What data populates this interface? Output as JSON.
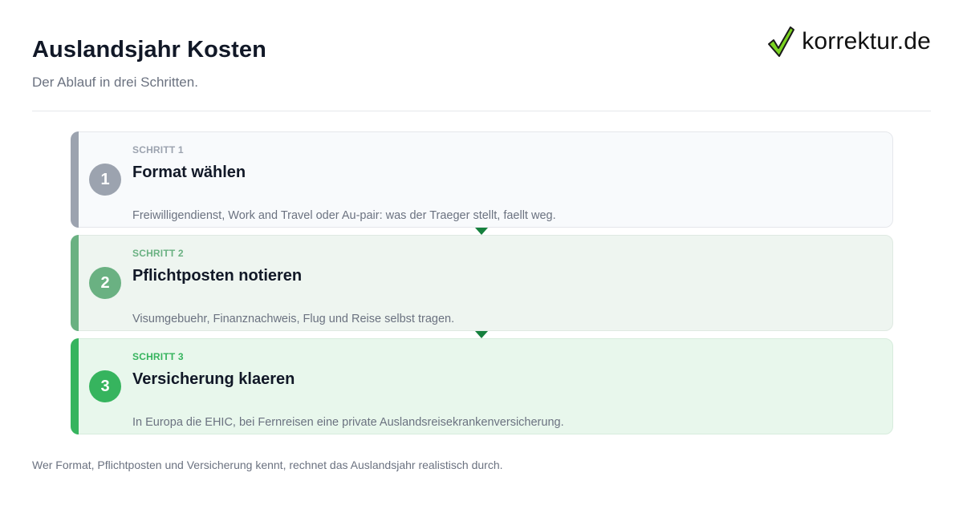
{
  "header": {
    "title": "Auslandsjahr Kosten",
    "subtitle": "Der Ablauf in drei Schritten.",
    "logo_text": "korrektur.de",
    "logo_icon": "checkmark-icon"
  },
  "steps": [
    {
      "number": "1",
      "label": "SCHRITT 1",
      "title": "Format wählen",
      "description": "Freiwilligendienst, Work and Travel oder Au-pair: was der Traeger stellt, faellt weg.",
      "accent": "#9ca3af",
      "background": "#f8fafc",
      "border": "#e5e7eb"
    },
    {
      "number": "2",
      "label": "SCHRITT 2",
      "title": "Pflichtposten notieren",
      "description": "Visumgebuehr, Finanznachweis, Flug und Reise selbst tragen.",
      "accent": "#6ab182",
      "background": "#eef5f0",
      "border": "#dfe9e2"
    },
    {
      "number": "3",
      "label": "SCHRITT 3",
      "title": "Versicherung klaeren",
      "description": "In Europa die EHIC, bei Fernreisen eine private Auslandsreisekrankenversicherung.",
      "accent": "#36b45e",
      "background": "#e8f7ec",
      "border": "#d7ecdd"
    }
  ],
  "connector_color": "#15803d",
  "footer": {
    "text": "Wer Format, Pflichtposten und Versicherung kennt, rechnet das Auslandsjahr realistisch durch."
  }
}
